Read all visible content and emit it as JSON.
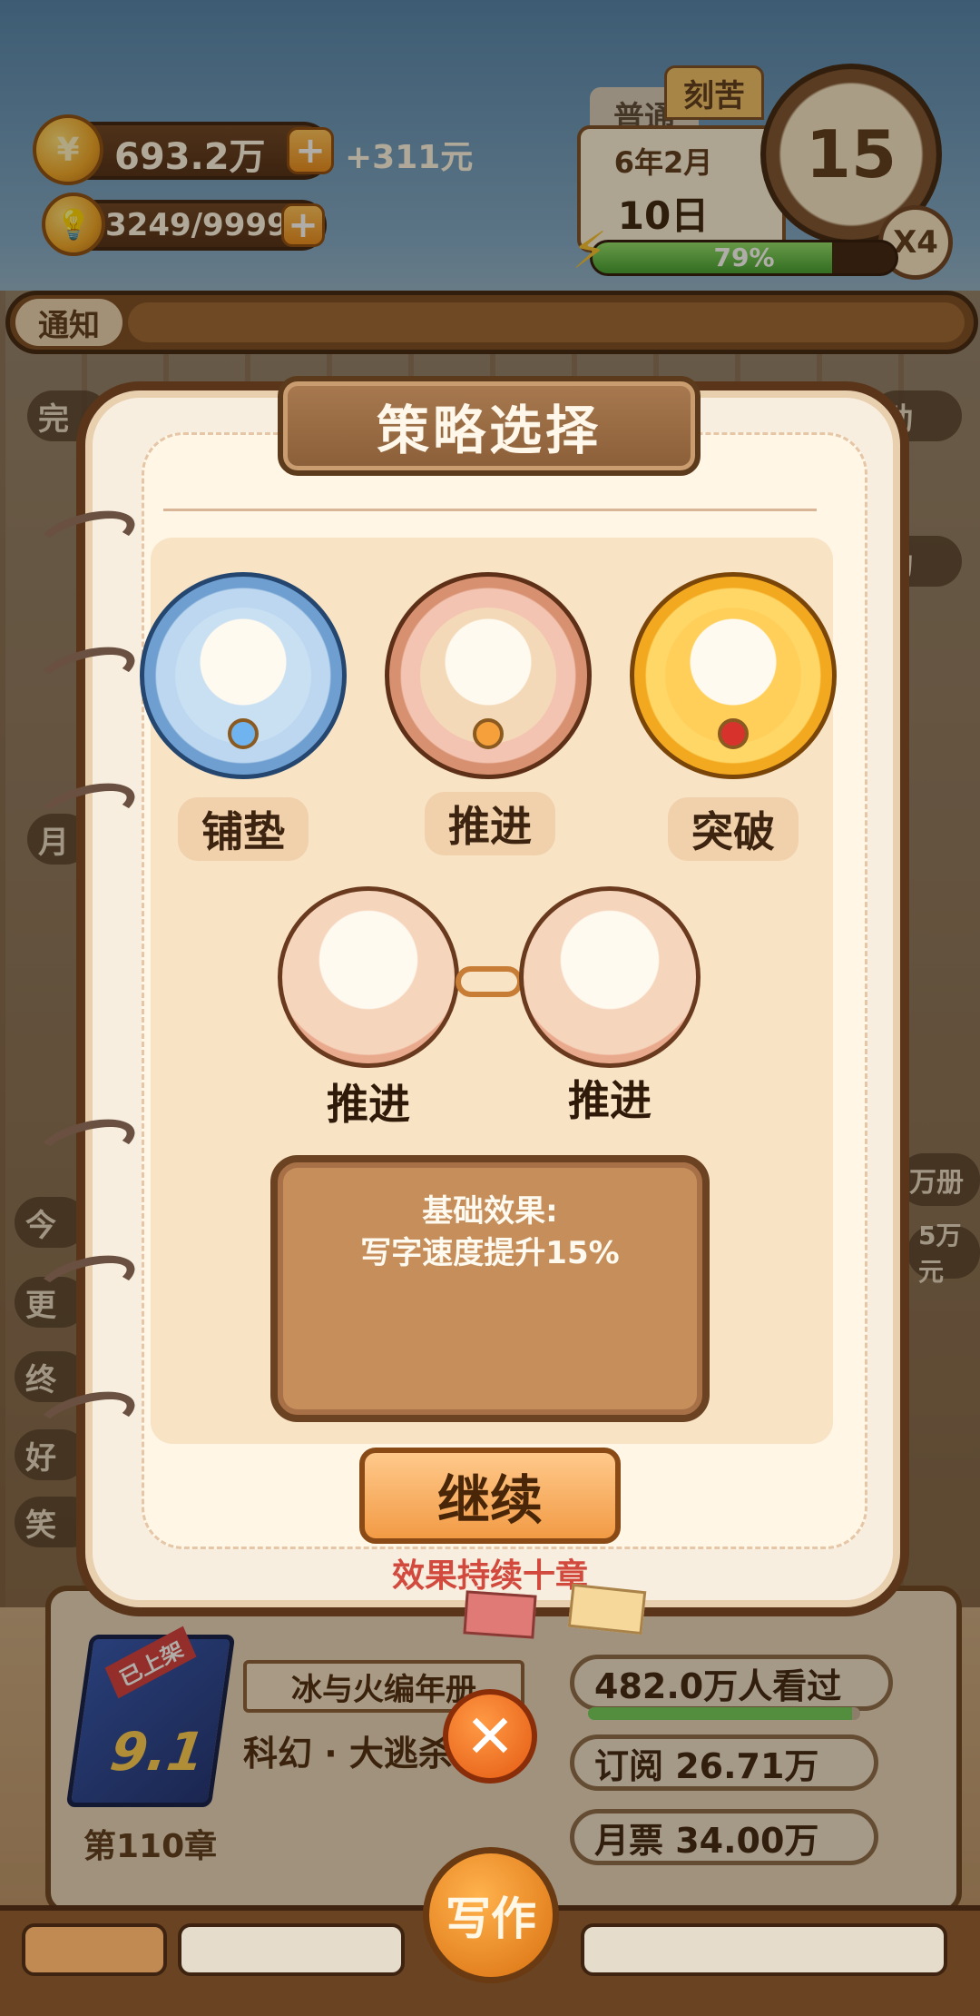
{
  "hud": {
    "coins": "693.2万",
    "coin_rate": "+311元",
    "ideas": "3249/9999",
    "mode_tabs": [
      "普通",
      "刻苦"
    ],
    "date_month": "6年2月",
    "date_day": "10日",
    "clock_value": "15",
    "speed": "X4",
    "energy_text": "79%",
    "energy_percent": 79
  },
  "notify": {
    "label": "通知"
  },
  "side": {
    "left_labels": [
      "完",
      "月",
      "今",
      "更",
      "终",
      "好",
      "笑"
    ],
    "right_labels": [
      "动",
      "动",
      "万册",
      "5万元"
    ]
  },
  "dialog": {
    "title": "策略选择",
    "options": [
      {
        "label": "铺垫",
        "icon": "setup-medal-icon"
      },
      {
        "label": "推进",
        "icon": "advance-medal-icon"
      },
      {
        "label": "突破",
        "icon": "breakthrough-medal-icon"
      }
    ],
    "slots": [
      {
        "label": "推进"
      },
      {
        "label": "推进"
      }
    ],
    "effect_title": "基础效果:",
    "effect_desc": "写字速度提升15%",
    "continue_label": "继续",
    "duration_text": "效果持续十章"
  },
  "book": {
    "badge": "已上架",
    "rating": "9.1",
    "chapter": "第110章",
    "title": "冰与火编年册",
    "genre": "科幻 · 大逃杀",
    "views": "482.0万人看过",
    "views_percent": 97,
    "subscriptions": "订阅  26.71万",
    "monthly_votes": "月票  34.00万"
  },
  "nav": {
    "write_label": "写作"
  }
}
